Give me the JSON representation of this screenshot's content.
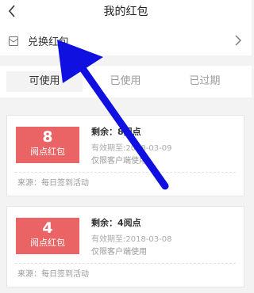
{
  "header": {
    "title": "我的红包",
    "back_icon": "chevron-left-icon"
  },
  "redeem": {
    "label": "兑换红包",
    "icon": "envelope-icon",
    "chevron": "chevron-right-icon"
  },
  "tabs": [
    {
      "label": "可使用",
      "active": true
    },
    {
      "label": "已使用",
      "active": false
    },
    {
      "label": "已过期",
      "active": false
    }
  ],
  "cards": [
    {
      "amount": "8",
      "unit_label": "阅点红包",
      "remaining": "剩余：8阅点",
      "expiry": "有效期至:2018-03-09",
      "scope": "仅限客户端使用",
      "source": "来源：每日签到活动"
    },
    {
      "amount": "4",
      "unit_label": "阅点红包",
      "remaining": "剩余：4阅点",
      "expiry": "有效期至:2018-03-08",
      "scope": "仅限客户端使用",
      "source": "来源：每日签到活动"
    }
  ],
  "colors": {
    "accent": "#ea6465",
    "annotation_arrow": "#1010e0"
  }
}
